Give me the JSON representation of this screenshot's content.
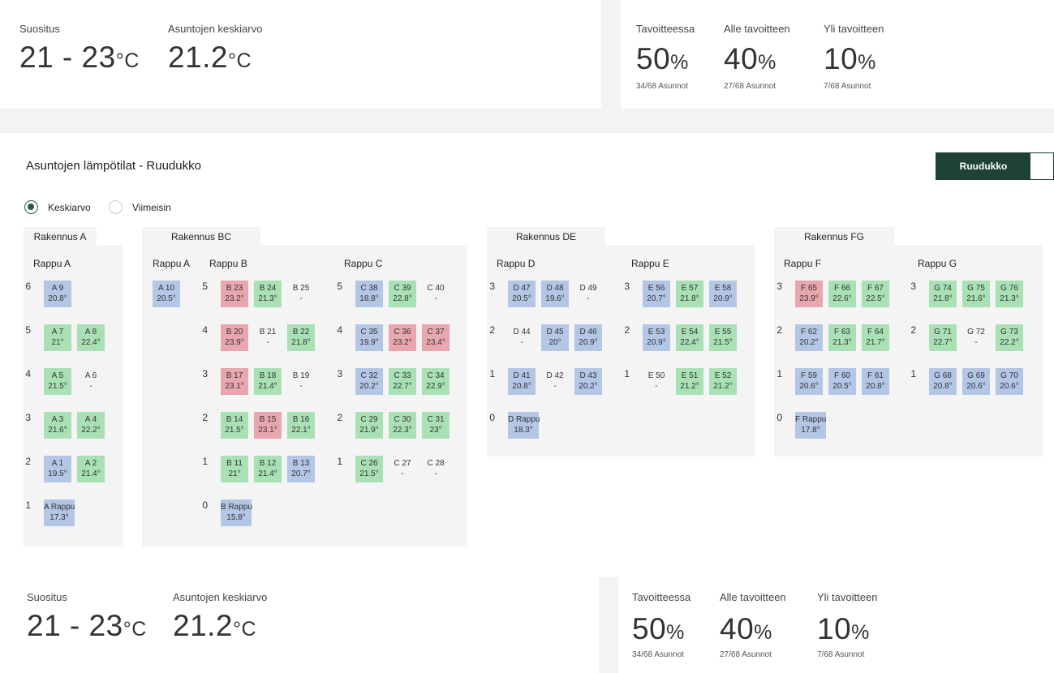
{
  "summary_labels": {
    "recommendation": "Suositus",
    "average": "Asuntojen keskiarvo",
    "on_target": "Tavoitteessa",
    "below": "Alle tavoitteen",
    "above": "Yli tavoitteen"
  },
  "summary_values": {
    "range": "21 - 23",
    "average": "21.2",
    "unit": "°C",
    "on_target": "50",
    "below": "40",
    "above": "10",
    "pct": "%",
    "on_target_sub": "34/68 Asunnot",
    "below_sub": "27/68 Asunnot",
    "above_sub": "7/68 Asunnot"
  },
  "grid_title": "Asuntojen lämpötilat - Ruudukko",
  "toggle": {
    "active": "Ruudukko"
  },
  "radios": {
    "average": "Keskiarvo",
    "latest": "Viimeisin"
  },
  "colors": {
    "primary": "#1e4236",
    "below_target": "#b3c6e6",
    "on_target": "#a9e1b5",
    "above_target": "#e8a6ae"
  },
  "buildings": [
    {
      "name": "Rakennus A",
      "stairs": [
        {
          "name": "Rappu A",
          "floors": [
            {
              "floor": "6",
              "cells": [
                {
                  "label": "A 9",
                  "temp": "20.8°",
                  "status": "blue"
                }
              ]
            },
            {
              "floor": "5",
              "cells": [
                {
                  "label": "A 7",
                  "temp": "21°",
                  "status": "green"
                },
                {
                  "label": "A 8",
                  "temp": "22.4°",
                  "status": "green"
                }
              ]
            },
            {
              "floor": "4",
              "cells": [
                {
                  "label": "A 5",
                  "temp": "21.5°",
                  "status": "green"
                },
                {
                  "label": "A 6",
                  "temp": "-",
                  "status": "none"
                }
              ]
            },
            {
              "floor": "3",
              "cells": [
                {
                  "label": "A 3",
                  "temp": "21.6°",
                  "status": "green"
                },
                {
                  "label": "A 4",
                  "temp": "22.2°",
                  "status": "green"
                }
              ]
            },
            {
              "floor": "2",
              "cells": [
                {
                  "label": "A 1",
                  "temp": "19.5°",
                  "status": "blue"
                },
                {
                  "label": "A 2",
                  "temp": "21.4°",
                  "status": "green"
                }
              ]
            },
            {
              "floor": "1",
              "cells": [
                {
                  "label": "A Rappu",
                  "temp": "17.3°",
                  "status": "blue"
                }
              ]
            }
          ]
        }
      ]
    },
    {
      "name": "Rakennus BC",
      "stairs": [
        {
          "name": "Rappu A",
          "floors": [
            {
              "floor": "",
              "cells": [
                {
                  "label": "A 10",
                  "temp": "20.5°",
                  "status": "blue"
                }
              ]
            }
          ]
        },
        {
          "name": "Rappu B",
          "floors": [
            {
              "floor": "5",
              "cells": [
                {
                  "label": "B 23",
                  "temp": "23.2°",
                  "status": "red"
                },
                {
                  "label": "B 24",
                  "temp": "21.3°",
                  "status": "green"
                },
                {
                  "label": "B 25",
                  "temp": "-",
                  "status": "none"
                }
              ]
            },
            {
              "floor": "4",
              "cells": [
                {
                  "label": "B 20",
                  "temp": "23.9°",
                  "status": "red"
                },
                {
                  "label": "B 21",
                  "temp": "-",
                  "status": "none"
                },
                {
                  "label": "B 22",
                  "temp": "21.8°",
                  "status": "green"
                }
              ]
            },
            {
              "floor": "3",
              "cells": [
                {
                  "label": "B 17",
                  "temp": "23.1°",
                  "status": "red"
                },
                {
                  "label": "B 18",
                  "temp": "21.4°",
                  "status": "green"
                },
                {
                  "label": "B 19",
                  "temp": "-",
                  "status": "none"
                }
              ]
            },
            {
              "floor": "2",
              "cells": [
                {
                  "label": "B 14",
                  "temp": "21.5°",
                  "status": "green"
                },
                {
                  "label": "B 15",
                  "temp": "23.1°",
                  "status": "red"
                },
                {
                  "label": "B 16",
                  "temp": "22.1°",
                  "status": "green"
                }
              ]
            },
            {
              "floor": "1",
              "cells": [
                {
                  "label": "B 11",
                  "temp": "21°",
                  "status": "green"
                },
                {
                  "label": "B 12",
                  "temp": "21.4°",
                  "status": "green"
                },
                {
                  "label": "B 13",
                  "temp": "20.7°",
                  "status": "blue"
                }
              ]
            },
            {
              "floor": "0",
              "cells": [
                {
                  "label": "B Rappu",
                  "temp": "15.8°",
                  "status": "blue"
                }
              ]
            }
          ]
        },
        {
          "name": "Rappu C",
          "floors": [
            {
              "floor": "5",
              "cells": [
                {
                  "label": "C 38",
                  "temp": "18.8°",
                  "status": "blue"
                },
                {
                  "label": "C 39",
                  "temp": "22.8°",
                  "status": "green"
                },
                {
                  "label": "C 40",
                  "temp": "-",
                  "status": "none"
                }
              ]
            },
            {
              "floor": "4",
              "cells": [
                {
                  "label": "C 35",
                  "temp": "19.9°",
                  "status": "blue"
                },
                {
                  "label": "C 36",
                  "temp": "23.2°",
                  "status": "red"
                },
                {
                  "label": "C 37",
                  "temp": "23.4°",
                  "status": "red"
                }
              ]
            },
            {
              "floor": "3",
              "cells": [
                {
                  "label": "C 32",
                  "temp": "20.2°",
                  "status": "blue"
                },
                {
                  "label": "C 33",
                  "temp": "22.7°",
                  "status": "green"
                },
                {
                  "label": "C 34",
                  "temp": "22.9°",
                  "status": "green"
                }
              ]
            },
            {
              "floor": "2",
              "cells": [
                {
                  "label": "C 29",
                  "temp": "21.9°",
                  "status": "green"
                },
                {
                  "label": "C 30",
                  "temp": "22.3°",
                  "status": "green"
                },
                {
                  "label": "C 31",
                  "temp": "23°",
                  "status": "green"
                }
              ]
            },
            {
              "floor": "1",
              "cells": [
                {
                  "label": "C 26",
                  "temp": "21.5°",
                  "status": "green"
                },
                {
                  "label": "C 27",
                  "temp": "-",
                  "status": "none"
                },
                {
                  "label": "C 28",
                  "temp": "-",
                  "status": "none"
                }
              ]
            }
          ]
        }
      ]
    },
    {
      "name": "Rakennus DE",
      "stairs": [
        {
          "name": "Rappu D",
          "floors": [
            {
              "floor": "3",
              "cells": [
                {
                  "label": "D 47",
                  "temp": "20.5°",
                  "status": "blue"
                },
                {
                  "label": "D 48",
                  "temp": "19.6°",
                  "status": "blue"
                },
                {
                  "label": "D 49",
                  "temp": "-",
                  "status": "none"
                }
              ]
            },
            {
              "floor": "2",
              "cells": [
                {
                  "label": "D 44",
                  "temp": "-",
                  "status": "none"
                },
                {
                  "label": "D 45",
                  "temp": "20°",
                  "status": "blue"
                },
                {
                  "label": "D 46",
                  "temp": "20.9°",
                  "status": "blue"
                }
              ]
            },
            {
              "floor": "1",
              "cells": [
                {
                  "label": "D 41",
                  "temp": "20.8°",
                  "status": "blue"
                },
                {
                  "label": "D 42",
                  "temp": "-",
                  "status": "none"
                },
                {
                  "label": "D 43",
                  "temp": "20.2°",
                  "status": "blue"
                }
              ]
            },
            {
              "floor": "0",
              "cells": [
                {
                  "label": "D Rappu",
                  "temp": "18.3°",
                  "status": "blue"
                }
              ]
            }
          ]
        },
        {
          "name": "Rappu E",
          "floors": [
            {
              "floor": "3",
              "cells": [
                {
                  "label": "E 56",
                  "temp": "20.7°",
                  "status": "blue"
                },
                {
                  "label": "E 57",
                  "temp": "21.8°",
                  "status": "green"
                },
                {
                  "label": "E 58",
                  "temp": "20.9°",
                  "status": "blue"
                }
              ]
            },
            {
              "floor": "2",
              "cells": [
                {
                  "label": "E 53",
                  "temp": "20.9°",
                  "status": "blue"
                },
                {
                  "label": "E 54",
                  "temp": "22.4°",
                  "status": "green"
                },
                {
                  "label": "E 55",
                  "temp": "21.5°",
                  "status": "green"
                }
              ]
            },
            {
              "floor": "1",
              "cells": [
                {
                  "label": "E 50",
                  "temp": "-",
                  "status": "none"
                },
                {
                  "label": "E 51",
                  "temp": "21.2°",
                  "status": "green"
                },
                {
                  "label": "E 52",
                  "temp": "21.2°",
                  "status": "green"
                }
              ]
            }
          ]
        }
      ]
    },
    {
      "name": "Rakennus FG",
      "stairs": [
        {
          "name": "Rappu F",
          "floors": [
            {
              "floor": "3",
              "cells": [
                {
                  "label": "F 65",
                  "temp": "23.9°",
                  "status": "red"
                },
                {
                  "label": "F 66",
                  "temp": "22.6°",
                  "status": "green"
                },
                {
                  "label": "F 67",
                  "temp": "22.5°",
                  "status": "green"
                }
              ]
            },
            {
              "floor": "2",
              "cells": [
                {
                  "label": "F 62",
                  "temp": "20.2°",
                  "status": "blue"
                },
                {
                  "label": "F 63",
                  "temp": "21.3°",
                  "status": "green"
                },
                {
                  "label": "F 64",
                  "temp": "21.7°",
                  "status": "green"
                }
              ]
            },
            {
              "floor": "1",
              "cells": [
                {
                  "label": "F 59",
                  "temp": "20.6°",
                  "status": "blue"
                },
                {
                  "label": "F 60",
                  "temp": "20.5°",
                  "status": "blue"
                },
                {
                  "label": "F 61",
                  "temp": "20.8°",
                  "status": "blue"
                }
              ]
            },
            {
              "floor": "0",
              "cells": [
                {
                  "label": "F Rappu",
                  "temp": "17.8°",
                  "status": "blue"
                }
              ]
            }
          ]
        },
        {
          "name": "Rappu G",
          "floors": [
            {
              "floor": "3",
              "cells": [
                {
                  "label": "G 74",
                  "temp": "21.8°",
                  "status": "green"
                },
                {
                  "label": "G 75",
                  "temp": "21.6°",
                  "status": "green"
                },
                {
                  "label": "G 76",
                  "temp": "21.3°",
                  "status": "green"
                }
              ]
            },
            {
              "floor": "2",
              "cells": [
                {
                  "label": "G 71",
                  "temp": "22.7°",
                  "status": "green"
                },
                {
                  "label": "G 72",
                  "temp": "-",
                  "status": "none"
                },
                {
                  "label": "G 73",
                  "temp": "22.2°",
                  "status": "green"
                }
              ]
            },
            {
              "floor": "1",
              "cells": [
                {
                  "label": "G 68",
                  "temp": "20.8°",
                  "status": "blue"
                },
                {
                  "label": "G 69",
                  "temp": "20.6°",
                  "status": "blue"
                },
                {
                  "label": "G 70",
                  "temp": "20.6°",
                  "status": "blue"
                }
              ]
            }
          ]
        }
      ]
    }
  ]
}
